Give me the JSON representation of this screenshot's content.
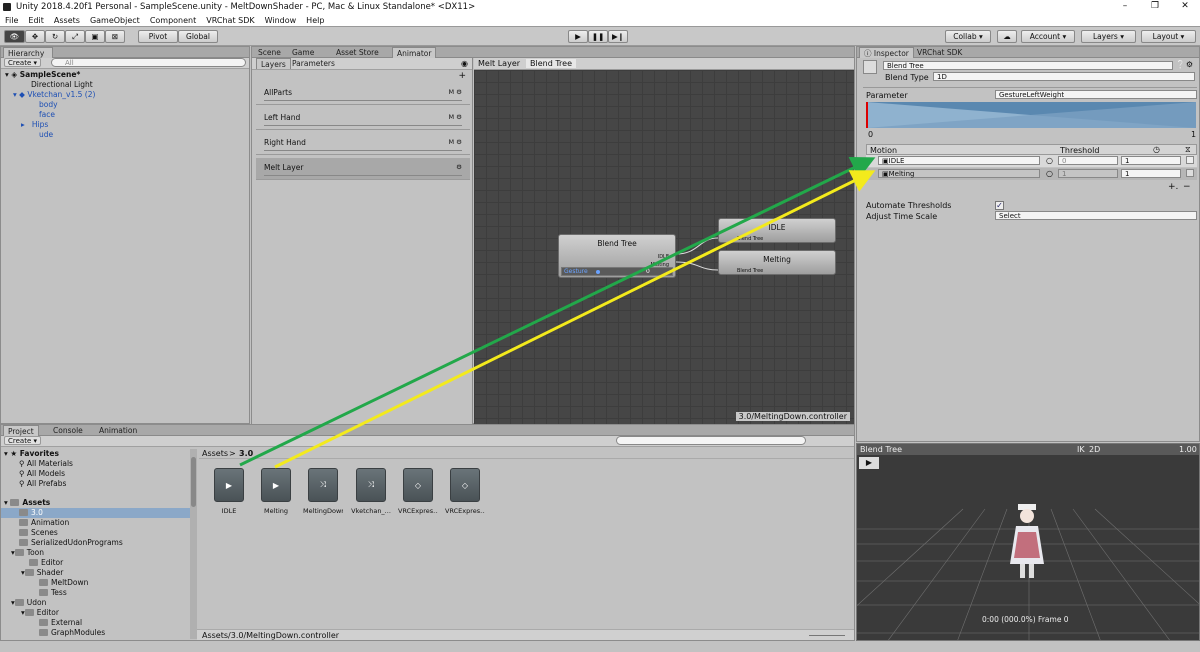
{
  "window": {
    "title": "Unity 2018.4.20f1 Personal - SampleScene.unity - MeltDownShader - PC, Mac & Linux Standalone* <DX11>"
  },
  "menu": [
    "File",
    "Edit",
    "Assets",
    "GameObject",
    "Component",
    "VRChat SDK",
    "Window",
    "Help"
  ],
  "toolbar": {
    "pivot": "Pivot",
    "global": "Global",
    "collab": "Collab",
    "account": "Account",
    "layers": "Layers",
    "layout": "Layout"
  },
  "hierarchy": {
    "tab": "Hierarchy",
    "create": "Create",
    "search_placeholder": "All",
    "scene": "SampleScene*",
    "items": [
      {
        "label": "Directional Light",
        "depth": 1,
        "blue": false
      },
      {
        "label": "Vketchan_v1.5 (2)",
        "depth": 1,
        "blue": true
      },
      {
        "label": "body",
        "depth": 2,
        "blue": true
      },
      {
        "label": "face",
        "depth": 2,
        "blue": true
      },
      {
        "label": "Hips",
        "depth": 2,
        "blue": true
      },
      {
        "label": "ude",
        "depth": 2,
        "blue": true
      }
    ]
  },
  "center_tabs": [
    "Scene",
    "Game",
    "Asset Store",
    "Animator"
  ],
  "animator": {
    "subtabs": [
      "Layers",
      "Parameters"
    ],
    "layers": [
      "AllParts",
      "Left Hand",
      "Right Hand",
      "Melt Layer"
    ],
    "breadcrumb": [
      "Melt Layer",
      "Blend Tree"
    ],
    "blend_node": {
      "title": "Blend Tree",
      "param": "Gesture",
      "value": "0",
      "out1": "IDLE",
      "out2": "Melting"
    },
    "states": [
      {
        "title": "IDLE",
        "sub": "Blend Tree"
      },
      {
        "title": "Melting",
        "sub": "Blend Tree"
      }
    ],
    "footer": "3.0/MeltingDown.controller"
  },
  "inspector": {
    "tabs": [
      "Inspector",
      "VRChat SDK"
    ],
    "name": "Blend Tree",
    "blend_type_label": "Blend Type",
    "blend_type": "1D",
    "parameter_label": "Parameter",
    "parameter": "GestureLeftWeight",
    "range_min": "0",
    "range_max": "1",
    "motion_header": "Motion",
    "threshold_header": "Threshold",
    "motions": [
      {
        "name": "IDLE",
        "threshold": "0",
        "speed": "1"
      },
      {
        "name": "Melting",
        "threshold": "1",
        "speed": "1"
      }
    ],
    "automate_label": "Automate Thresholds",
    "automate_checked": true,
    "adjust_label": "Adjust Time Scale",
    "adjust_value": "Select"
  },
  "project": {
    "tabs": [
      "Project",
      "Console",
      "Animation"
    ],
    "create": "Create",
    "favorites_label": "Favorites",
    "favorites": [
      "All Materials",
      "All Models",
      "All Prefabs"
    ],
    "assets_label": "Assets",
    "folders": [
      {
        "label": "3.0",
        "depth": 1,
        "selected": true
      },
      {
        "label": "Animation",
        "depth": 1
      },
      {
        "label": "Scenes",
        "depth": 1
      },
      {
        "label": "SerializedUdonPrograms",
        "depth": 1
      },
      {
        "label": "Toon",
        "depth": 1
      },
      {
        "label": "Editor",
        "depth": 2
      },
      {
        "label": "Shader",
        "depth": 2
      },
      {
        "label": "MeltDown",
        "depth": 3
      },
      {
        "label": "Tess",
        "depth": 3
      },
      {
        "label": "Udon",
        "depth": 1
      },
      {
        "label": "Editor",
        "depth": 2
      },
      {
        "label": "External",
        "depth": 3
      },
      {
        "label": "GraphModules",
        "depth": 3
      }
    ],
    "path": [
      "Assets",
      "3.0"
    ],
    "assets": [
      {
        "label": "IDLE",
        "icon": "play-icon"
      },
      {
        "label": "Melting",
        "icon": "play-icon"
      },
      {
        "label": "MeltingDown",
        "icon": "animator-controller-icon"
      },
      {
        "label": "Vketchan_...",
        "icon": "animator-controller-icon"
      },
      {
        "label": "VRCExpres...",
        "icon": "unity-asset-icon"
      },
      {
        "label": "VRCExpres...",
        "icon": "unity-asset-icon"
      }
    ],
    "status": "Assets/3.0/MeltingDown.controller"
  },
  "preview": {
    "title": "Blend Tree",
    "ik": "IK",
    "mode": "2D",
    "speed": "1.00",
    "frame": "0:00 (000.0%) Frame 0"
  },
  "colors": {
    "green_arrow": "#22a84a",
    "yellow_arrow": "#f3ea1c",
    "graph_bg": "#464646"
  }
}
